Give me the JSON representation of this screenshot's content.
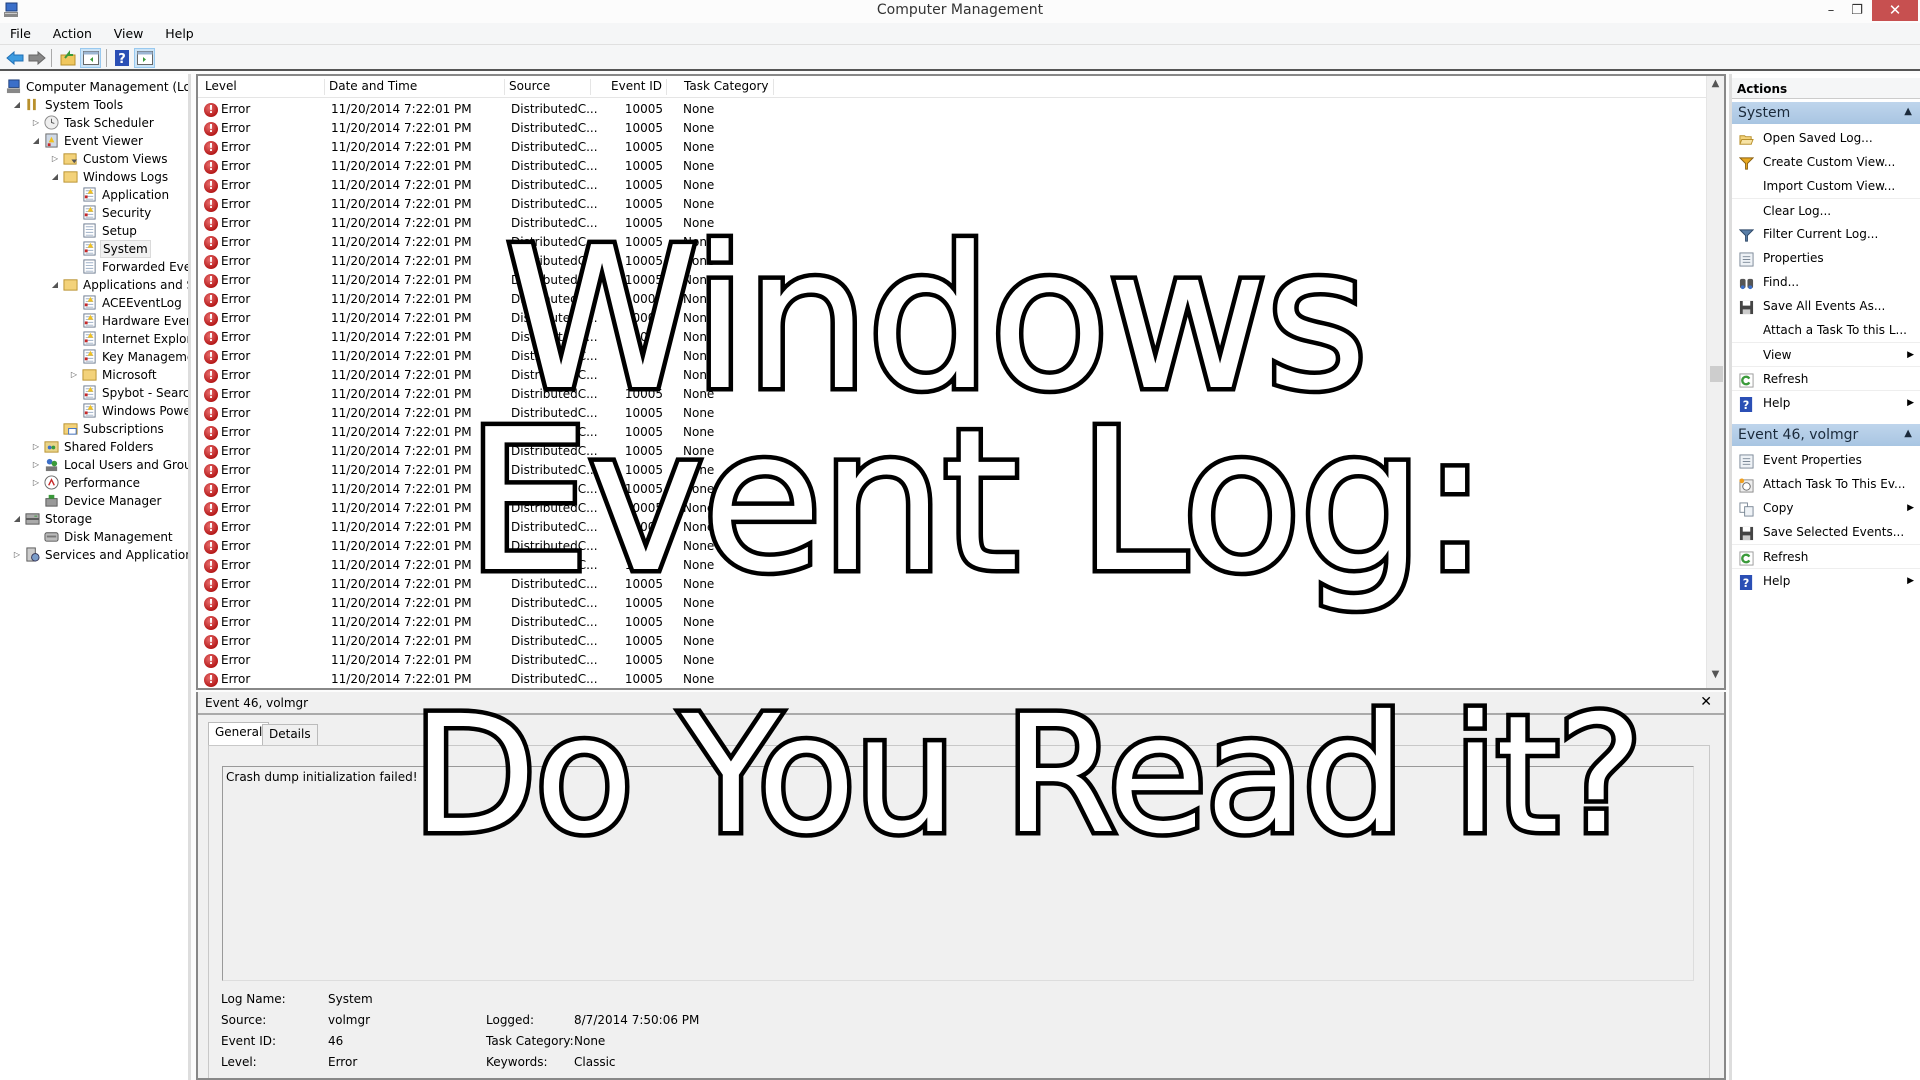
{
  "window": {
    "title": "Computer Management",
    "minimize": "–",
    "maximize": "❐",
    "close": "✕"
  },
  "menu": [
    "File",
    "Action",
    "View",
    "Help"
  ],
  "toolbar": [
    "back-icon",
    "forward-icon",
    "up-folder-icon",
    "show-hide-tree-icon",
    "help-icon",
    "show-hide-action-pane-icon"
  ],
  "tree": [
    {
      "label": "Computer Management (Local",
      "level": 0,
      "exp": "",
      "icon": "computer-icon"
    },
    {
      "label": "System Tools",
      "level": 1,
      "exp": "open",
      "icon": "tools-icon"
    },
    {
      "label": "Task Scheduler",
      "level": 2,
      "exp": "closed",
      "icon": "clock-icon"
    },
    {
      "label": "Event Viewer",
      "level": 2,
      "exp": "open",
      "icon": "event-viewer-icon"
    },
    {
      "label": "Custom Views",
      "level": 3,
      "exp": "closed",
      "icon": "folder-filter-icon"
    },
    {
      "label": "Windows Logs",
      "level": 3,
      "exp": "open",
      "icon": "folder-icon"
    },
    {
      "label": "Application",
      "level": 4,
      "exp": "",
      "icon": "log-icon"
    },
    {
      "label": "Security",
      "level": 4,
      "exp": "",
      "icon": "log-icon"
    },
    {
      "label": "Setup",
      "level": 4,
      "exp": "",
      "icon": "log-plain-icon"
    },
    {
      "label": "System",
      "level": 4,
      "exp": "",
      "icon": "log-icon",
      "selected": true
    },
    {
      "label": "Forwarded Event",
      "level": 4,
      "exp": "",
      "icon": "log-plain-icon"
    },
    {
      "label": "Applications and Se",
      "level": 3,
      "exp": "open",
      "icon": "folder-icon"
    },
    {
      "label": "ACEEventLog",
      "level": 4,
      "exp": "",
      "icon": "log-icon"
    },
    {
      "label": "Hardware Events",
      "level": 4,
      "exp": "",
      "icon": "log-icon"
    },
    {
      "label": "Internet Explorer",
      "level": 4,
      "exp": "",
      "icon": "log-icon"
    },
    {
      "label": "Key Managemer",
      "level": 4,
      "exp": "",
      "icon": "log-icon"
    },
    {
      "label": "Microsoft",
      "level": 4,
      "exp": "closed",
      "icon": "folder-icon"
    },
    {
      "label": "Spybot - Search",
      "level": 4,
      "exp": "",
      "icon": "log-icon"
    },
    {
      "label": "Windows Power",
      "level": 4,
      "exp": "",
      "icon": "log-icon"
    },
    {
      "label": "Subscriptions",
      "level": 3,
      "exp": "",
      "icon": "subscriptions-icon"
    },
    {
      "label": "Shared Folders",
      "level": 2,
      "exp": "closed",
      "icon": "shared-folder-icon"
    },
    {
      "label": "Local Users and Groups",
      "level": 2,
      "exp": "closed",
      "icon": "users-icon"
    },
    {
      "label": "Performance",
      "level": 2,
      "exp": "closed",
      "icon": "performance-icon"
    },
    {
      "label": "Device Manager",
      "level": 2,
      "exp": "",
      "icon": "device-manager-icon"
    },
    {
      "label": "Storage",
      "level": 1,
      "exp": "open",
      "icon": "storage-icon"
    },
    {
      "label": "Disk Management",
      "level": 2,
      "exp": "",
      "icon": "disk-icon"
    },
    {
      "label": "Services and Applications",
      "level": 1,
      "exp": "closed",
      "icon": "services-icon"
    }
  ],
  "list": {
    "columns": [
      "Level",
      "Date and Time",
      "Source",
      "Event ID",
      "Task Category"
    ],
    "rows_count": 31,
    "row": {
      "level": "Error",
      "datetime": "11/20/2014 7:22:01 PM",
      "source": "DistributedC...",
      "event_id": "10005",
      "task_category": "None"
    }
  },
  "details": {
    "title": "Event 46, volmgr",
    "close": "✕",
    "tabs": [
      "General",
      "Details"
    ],
    "active_tab": "General",
    "description": "Crash dump initialization failed!",
    "props": {
      "log_name_label": "Log Name:",
      "log_name": "System",
      "source_label": "Source:",
      "source": "volmgr",
      "event_id_label": "Event ID:",
      "event_id": "46",
      "level_label": "Level:",
      "level": "Error",
      "logged_label": "Logged:",
      "logged": "8/7/2014 7:50:06 PM",
      "task_category_label": "Task Category:",
      "task_category": "None",
      "keywords_label": "Keywords:",
      "keywords": "Classic"
    }
  },
  "actions": {
    "header": "Actions",
    "groups": [
      {
        "title": "System",
        "items": [
          {
            "label": "Open Saved Log...",
            "icon": "open-folder-icon"
          },
          {
            "label": "Create Custom View...",
            "icon": "filter-yellow-icon"
          },
          {
            "label": "Import Custom View...",
            "icon": ""
          },
          {
            "label": "Clear Log...",
            "icon": "",
            "sep": true
          },
          {
            "label": "Filter Current Log...",
            "icon": "filter-icon"
          },
          {
            "label": "Properties",
            "icon": "properties-icon"
          },
          {
            "label": "Find...",
            "icon": "binoculars-icon"
          },
          {
            "label": "Save All Events As...",
            "icon": "save-icon"
          },
          {
            "label": "Attach a Task To this L...",
            "icon": ""
          },
          {
            "label": "View",
            "icon": "",
            "submenu": true,
            "sep": true
          },
          {
            "label": "Refresh",
            "icon": "refresh-icon",
            "sep": true
          },
          {
            "label": "Help",
            "icon": "help-icon",
            "submenu": true,
            "sep": true
          }
        ]
      },
      {
        "title": "Event 46, volmgr",
        "items": [
          {
            "label": "Event Properties",
            "icon": "properties-icon"
          },
          {
            "label": "Attach Task To This Ev...",
            "icon": "task-clock-icon"
          },
          {
            "label": "Copy",
            "icon": "copy-icon",
            "submenu": true
          },
          {
            "label": "Save Selected Events...",
            "icon": "save-icon"
          },
          {
            "label": "Refresh",
            "icon": "refresh-icon",
            "sep": true
          },
          {
            "label": "Help",
            "icon": "help-icon",
            "submenu": true,
            "sep": true
          }
        ]
      }
    ]
  },
  "overlay": {
    "line1": "Windows",
    "line2": "Event Log:",
    "line3": "Do You Read it?"
  },
  "colors": {
    "error": "#c62828",
    "action_group": "#b4cde7",
    "close_button": "#c75050",
    "help_blue": "#2b4fb5",
    "refresh_green": "#3a9a3a"
  }
}
